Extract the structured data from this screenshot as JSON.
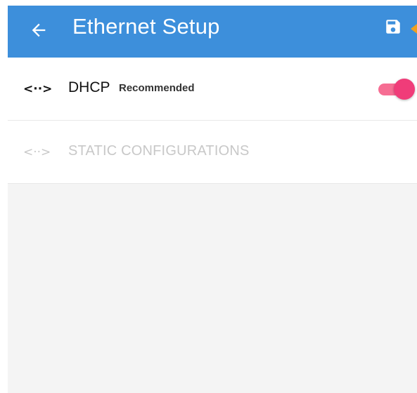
{
  "appbar": {
    "title": "Ethernet Setup",
    "back_icon": "arrow-left-icon",
    "save_icon": "floppy-disk-icon",
    "background_color": "#3d8fdb"
  },
  "options": [
    {
      "icon_glyph": "<··>",
      "icon_name": "ethernet-icon",
      "title": "DHCP",
      "subtitle": "Recommended",
      "enabled": true,
      "toggle_on": true,
      "toggle_color": "#f03c79"
    },
    {
      "icon_glyph": "<··>",
      "icon_name": "ethernet-icon",
      "title": "STATIC CONFIGURATIONS",
      "enabled": false
    }
  ]
}
